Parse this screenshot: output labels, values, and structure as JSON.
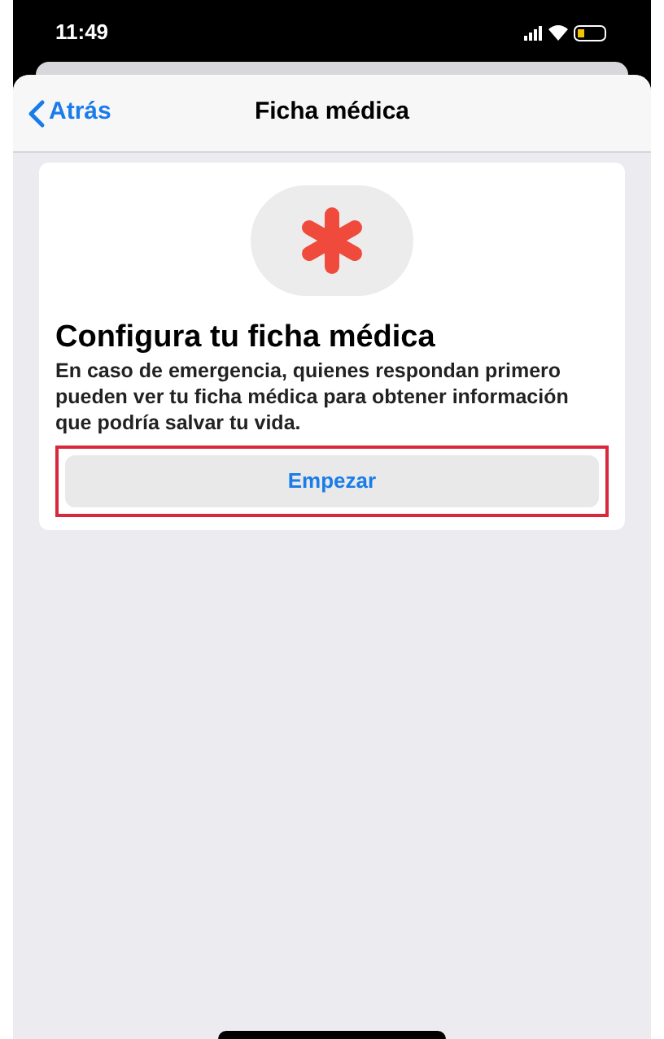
{
  "status_bar": {
    "time": "11:49"
  },
  "nav_bar": {
    "back_label": "Atrás",
    "title": "Ficha médica"
  },
  "card": {
    "heading": "Configura tu ficha médica",
    "body": "En caso de emergencia, quienes respondan primero pueden ver tu ficha médica para obtener información que podría salvar tu vida.",
    "button": {
      "label": "Empezar",
      "highlighted": true
    }
  }
}
